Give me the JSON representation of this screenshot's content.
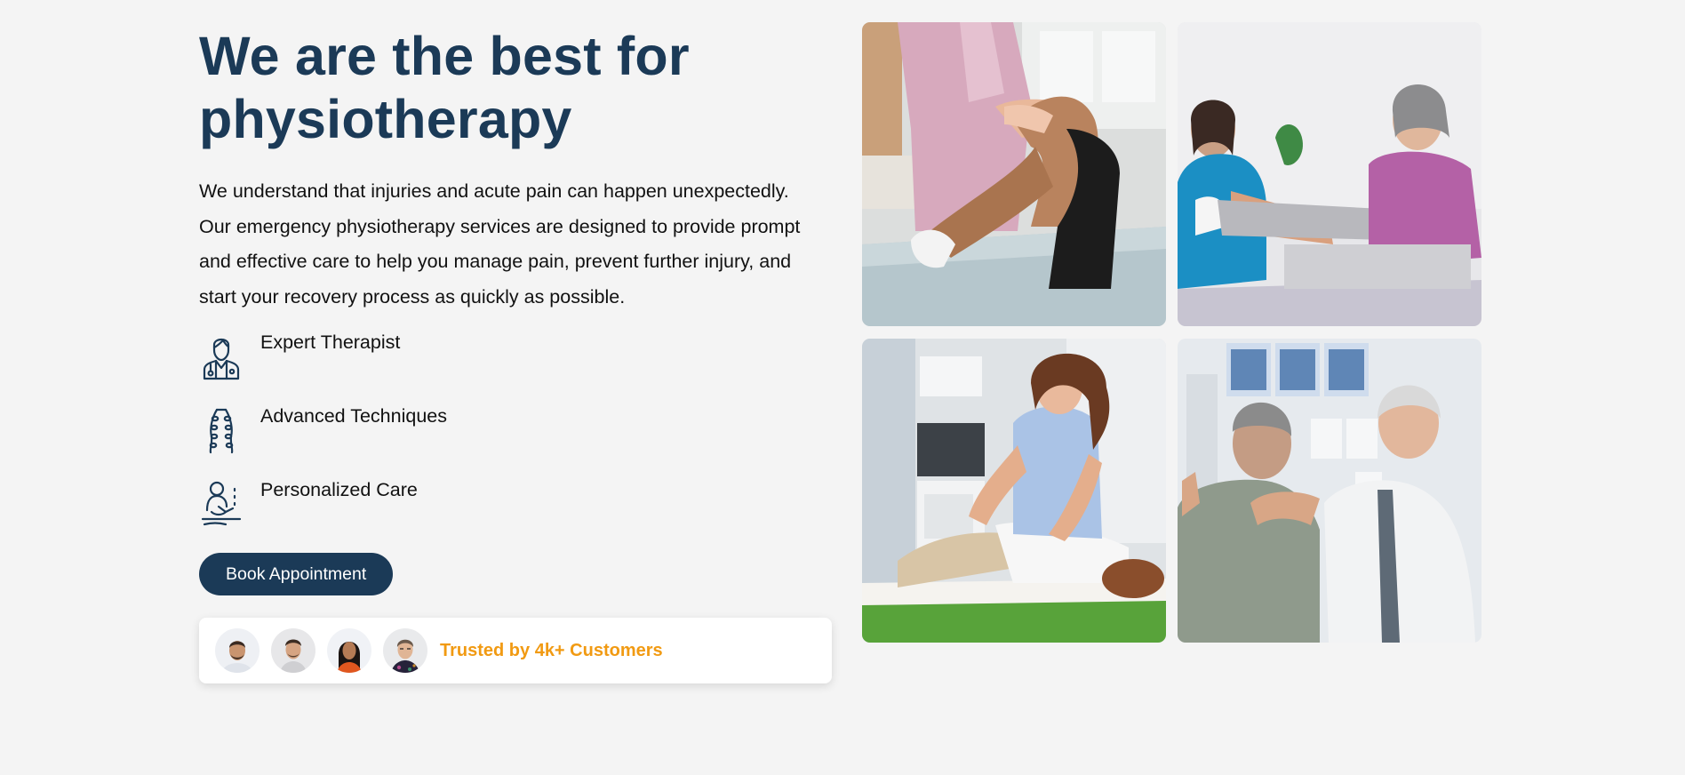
{
  "hero": {
    "title_line1": "We are the best for",
    "title_line2": "physiotherapy",
    "intro_line1": "We understand that injuries and acute pain can happen unexpectedly.",
    "intro_line2": "Our emergency physiotherapy services are designed to provide prompt",
    "intro_line3": "and effective care to help you manage pain, prevent further injury, and",
    "intro_line4": "start your recovery process as quickly as possible."
  },
  "features": [
    {
      "label": "Expert Therapist",
      "icon": "doctor-icon"
    },
    {
      "label": "Advanced Techniques",
      "icon": "spine-icon"
    },
    {
      "label": "Personalized Care",
      "icon": "massage-icon"
    }
  ],
  "cta": {
    "label": "Book Appointment"
  },
  "trust": {
    "text": "Trusted by 4k+ Customers",
    "avatars": [
      "customer-avatar-1",
      "customer-avatar-2",
      "customer-avatar-3",
      "customer-avatar-4"
    ]
  },
  "gallery": [
    {
      "name": "knee-therapy-photo"
    },
    {
      "name": "leg-stretch-photo"
    },
    {
      "name": "back-massage-photo"
    },
    {
      "name": "shoulder-exam-photo"
    }
  ],
  "colors": {
    "primary": "#1b3a57",
    "accent": "#f19a12",
    "background": "#f4f4f4"
  }
}
